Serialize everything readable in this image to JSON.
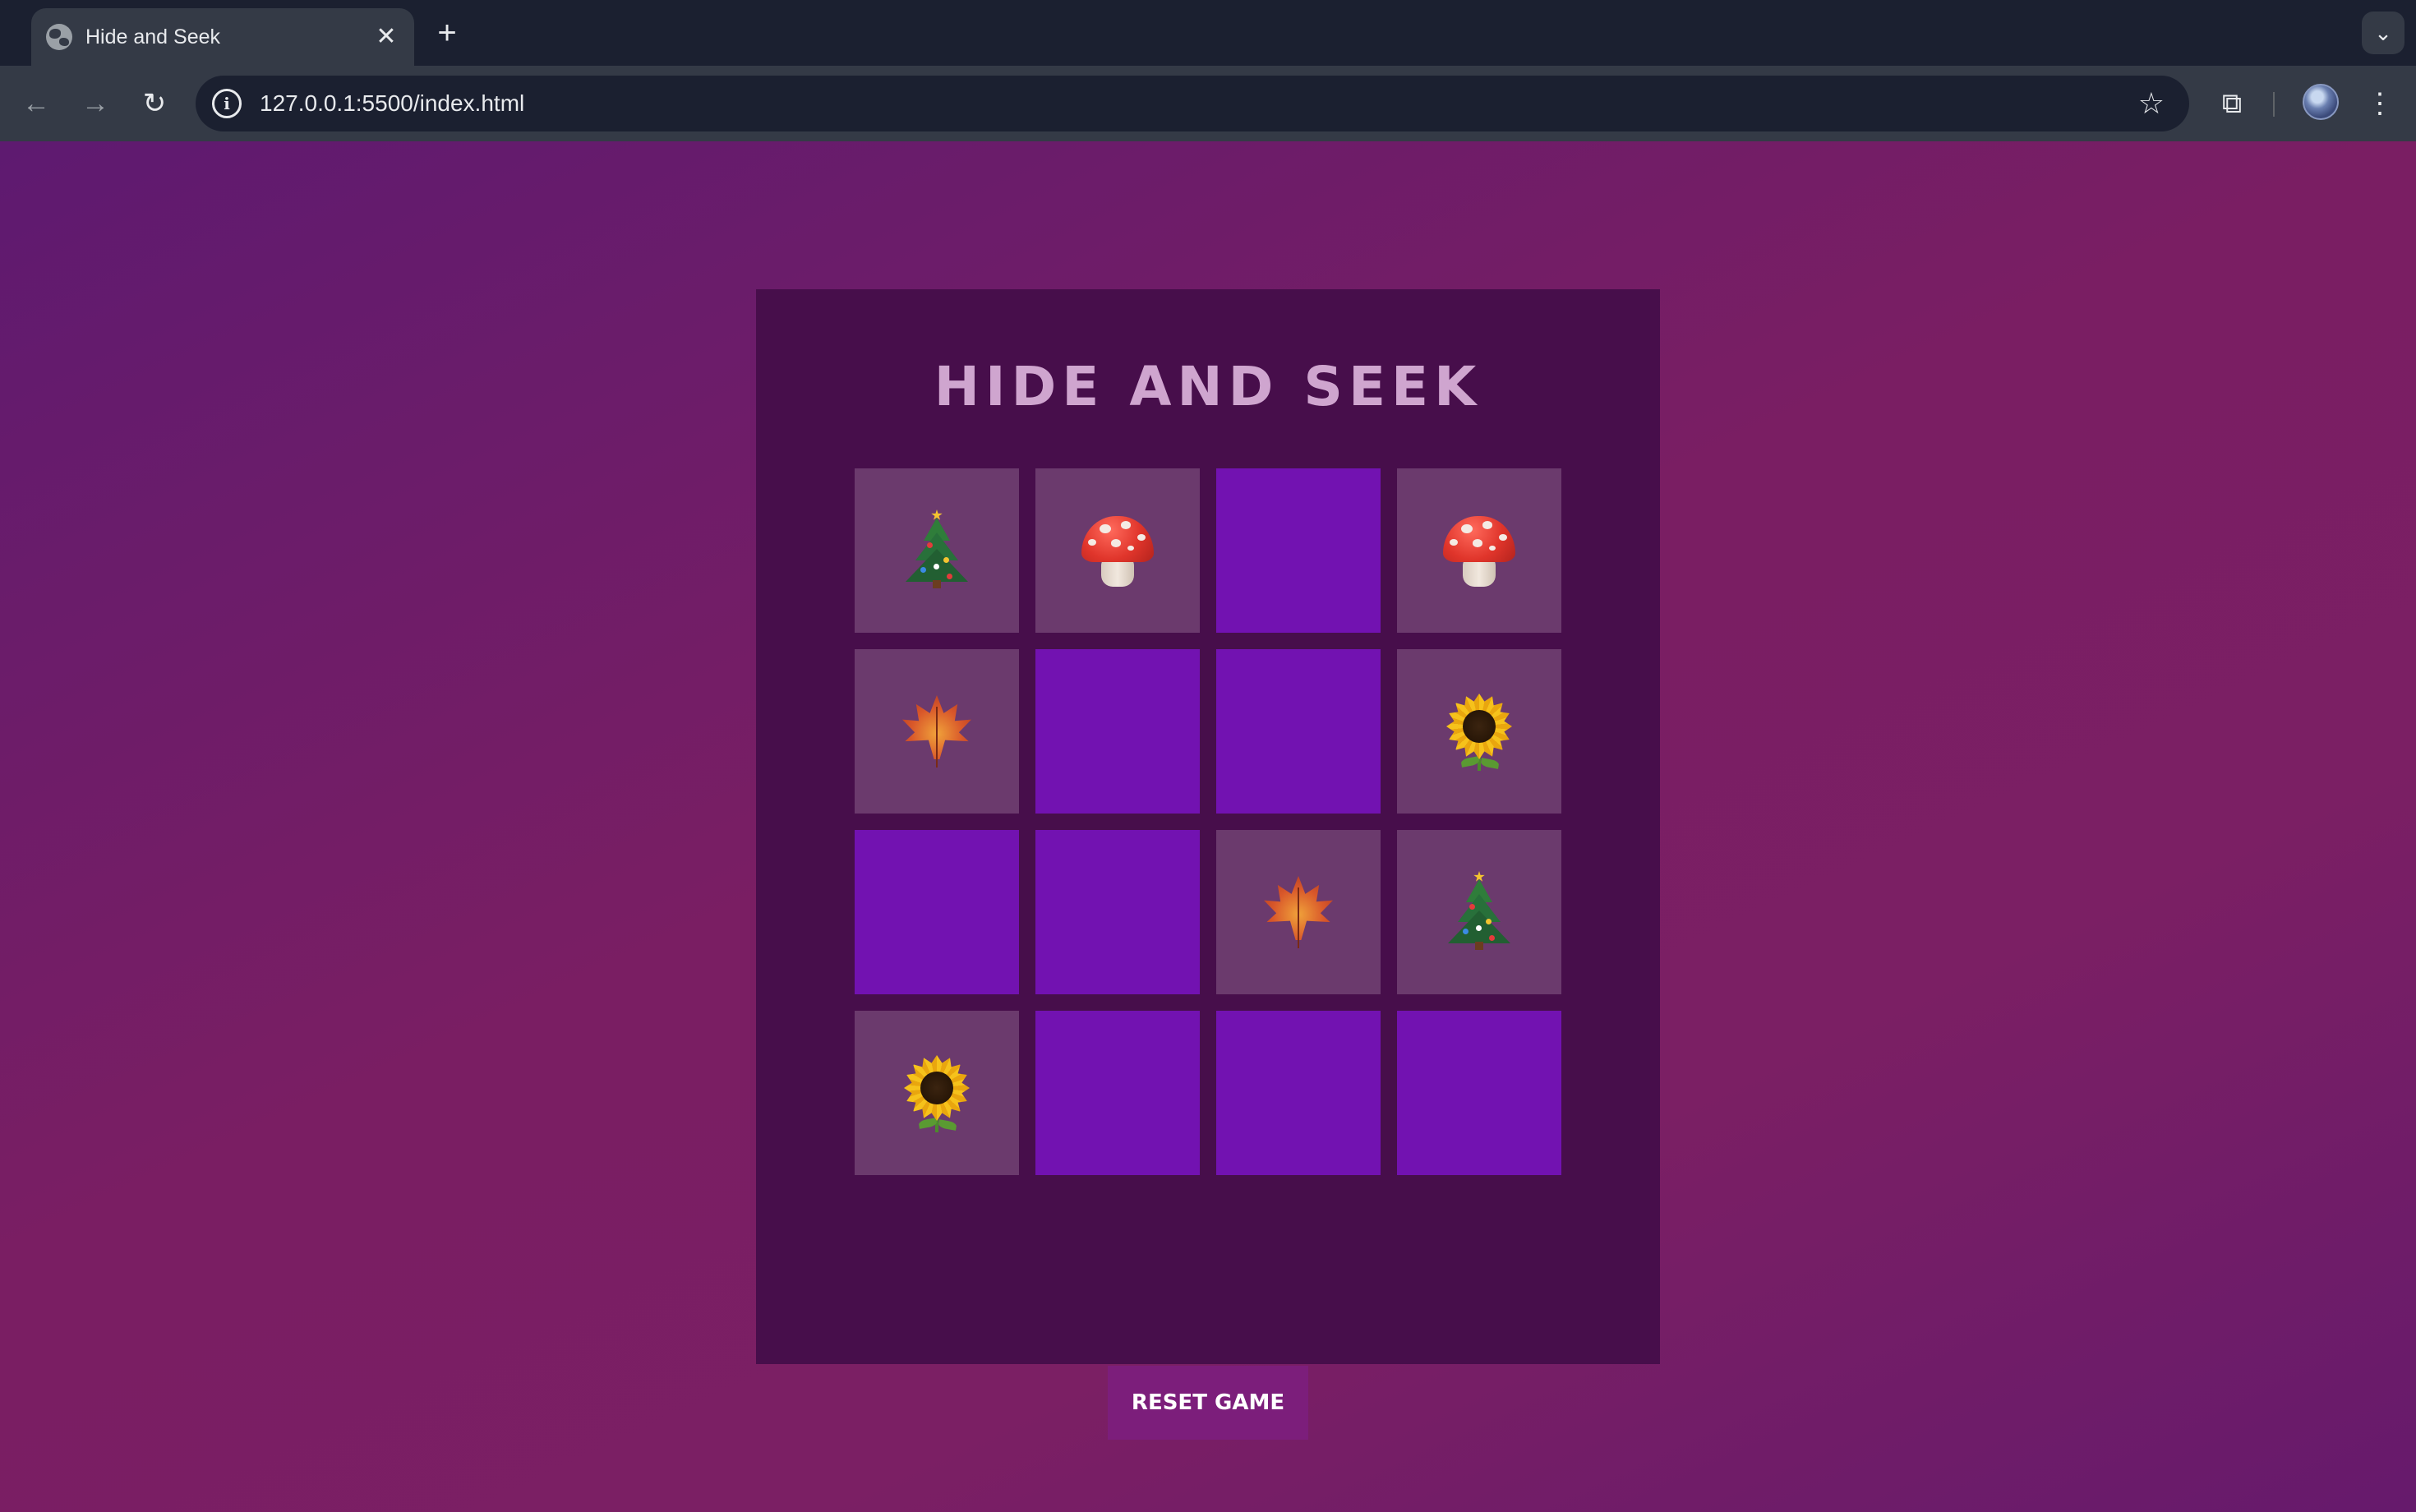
{
  "browser": {
    "tab_title": "Hide and Seek",
    "tab_close": "✕",
    "new_tab": "+",
    "tab_search": "⌄",
    "url": "127.0.0.1:5500/index.html",
    "back": "←",
    "forward": "→",
    "reload": "↻",
    "site_info": "i",
    "bookmark": "☆",
    "extensions": "⧉",
    "menu": "⋮"
  },
  "game": {
    "title": "HIDE AND SEEK",
    "reset_label": "RESET GAME",
    "colors": {
      "card": "#470e4b",
      "revealed_cell": "#6b3a6d",
      "hidden_cell": "#7212b1",
      "button": "#7c1e7b",
      "title": "#cfa5cf"
    },
    "grid": [
      {
        "state": "revealed",
        "icon": "christmas-tree"
      },
      {
        "state": "revealed",
        "icon": "mushroom"
      },
      {
        "state": "hidden",
        "icon": ""
      },
      {
        "state": "revealed",
        "icon": "mushroom"
      },
      {
        "state": "revealed",
        "icon": "maple-leaf"
      },
      {
        "state": "hidden",
        "icon": ""
      },
      {
        "state": "hidden",
        "icon": ""
      },
      {
        "state": "revealed",
        "icon": "sunflower"
      },
      {
        "state": "hidden",
        "icon": ""
      },
      {
        "state": "hidden",
        "icon": ""
      },
      {
        "state": "revealed",
        "icon": "maple-leaf"
      },
      {
        "state": "revealed",
        "icon": "christmas-tree"
      },
      {
        "state": "revealed",
        "icon": "sunflower"
      },
      {
        "state": "hidden",
        "icon": ""
      },
      {
        "state": "hidden",
        "icon": ""
      },
      {
        "state": "hidden",
        "icon": ""
      }
    ]
  }
}
